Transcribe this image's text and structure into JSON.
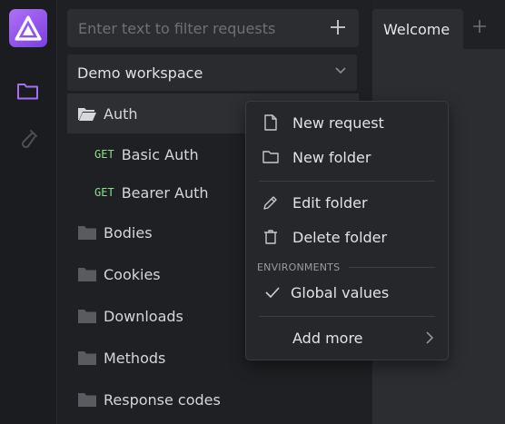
{
  "filter": {
    "placeholder": "Enter text to filter requests"
  },
  "workspace": {
    "name": "Demo workspace"
  },
  "tree": {
    "items": [
      {
        "type": "folder",
        "label": "Auth",
        "open": true
      },
      {
        "type": "request",
        "method": "GET",
        "label": "Basic Auth"
      },
      {
        "type": "request",
        "method": "GET",
        "label": "Bearer Auth"
      },
      {
        "type": "folder",
        "label": "Bodies"
      },
      {
        "type": "folder",
        "label": "Cookies"
      },
      {
        "type": "folder",
        "label": "Downloads"
      },
      {
        "type": "folder",
        "label": "Methods"
      },
      {
        "type": "folder",
        "label": "Response codes"
      }
    ]
  },
  "tabs": {
    "welcome": "Welcome"
  },
  "context_menu": {
    "new_request": "New request",
    "new_folder": "New folder",
    "edit_folder": "Edit folder",
    "delete_folder": "Delete folder",
    "section_environments": "ENVIRONMENTS",
    "global_values": "Global values",
    "add_more": "Add more"
  },
  "colors": {
    "accent": "#9a5cf0",
    "method_get": "#8ae08e",
    "background": "#1e1f22"
  },
  "icons": {
    "rail_collection": "folder-icon",
    "rail_environment": "flask-icon"
  }
}
